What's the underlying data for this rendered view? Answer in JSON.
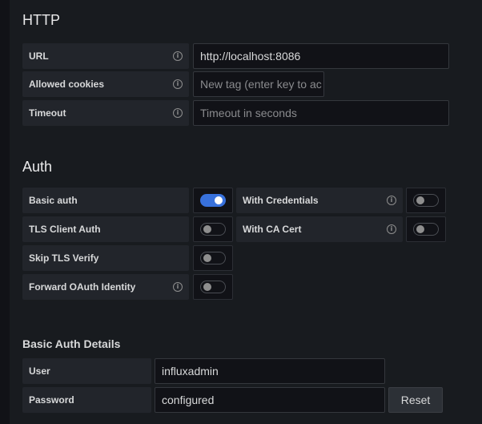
{
  "http": {
    "title": "HTTP",
    "url": {
      "label": "URL",
      "value": "http://localhost:8086"
    },
    "allowed_cookies": {
      "label": "Allowed cookies",
      "placeholder": "New tag (enter key to ac"
    },
    "timeout": {
      "label": "Timeout",
      "placeholder": "Timeout in seconds"
    }
  },
  "auth": {
    "title": "Auth",
    "basic_auth": {
      "label": "Basic auth",
      "enabled": true
    },
    "with_credentials": {
      "label": "With Credentials",
      "enabled": false
    },
    "tls_client_auth": {
      "label": "TLS Client Auth",
      "enabled": false
    },
    "with_ca_cert": {
      "label": "With CA Cert",
      "enabled": false
    },
    "skip_tls_verify": {
      "label": "Skip TLS Verify",
      "enabled": false
    },
    "forward_oauth": {
      "label": "Forward OAuth Identity",
      "enabled": false
    }
  },
  "basic_auth_details": {
    "title": "Basic Auth Details",
    "user": {
      "label": "User",
      "value": "influxadmin"
    },
    "password": {
      "label": "Password",
      "value": "configured"
    },
    "reset_label": "Reset"
  },
  "icons": {
    "info": "info-icon"
  },
  "colors": {
    "accent": "#3871dc",
    "background": "#181b1f"
  }
}
